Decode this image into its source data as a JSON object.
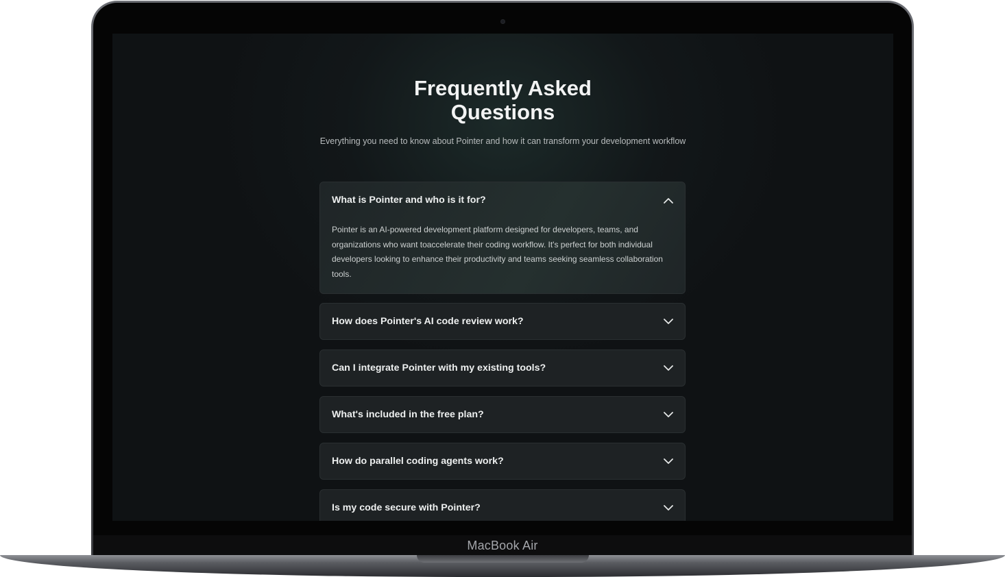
{
  "device": {
    "label": "MacBook Air"
  },
  "faq": {
    "title": "Frequently Asked\nQuestions",
    "subtitle": "Everything you need to know about Pointer and how it can transform your development workflow",
    "items": [
      {
        "question": "What is Pointer and who is it for?",
        "answer": "Pointer is an AI-powered development platform designed for developers, teams, and organizations who want toaccelerate their coding workflow. It's perfect for both individual developers looking to enhance their productivity and teams seeking seamless collaboration tools.",
        "expanded": true,
        "icon": "chevron-up-icon"
      },
      {
        "question": "How does Pointer's AI code review work?",
        "expanded": false,
        "icon": "chevron-down-icon"
      },
      {
        "question": "Can I integrate Pointer with my existing tools?",
        "expanded": false,
        "icon": "chevron-down-icon"
      },
      {
        "question": "What's included in the free plan?",
        "expanded": false,
        "icon": "chevron-down-icon"
      },
      {
        "question": "How do parallel coding agents work?",
        "expanded": false,
        "icon": "chevron-down-icon"
      },
      {
        "question": "Is my code secure with Pointer?",
        "expanded": false,
        "icon": "chevron-down-icon"
      }
    ]
  },
  "colors": {
    "background": "#121719",
    "card": "#1e2224",
    "text": "#eef0f0",
    "muted": "#b8bcbd"
  }
}
